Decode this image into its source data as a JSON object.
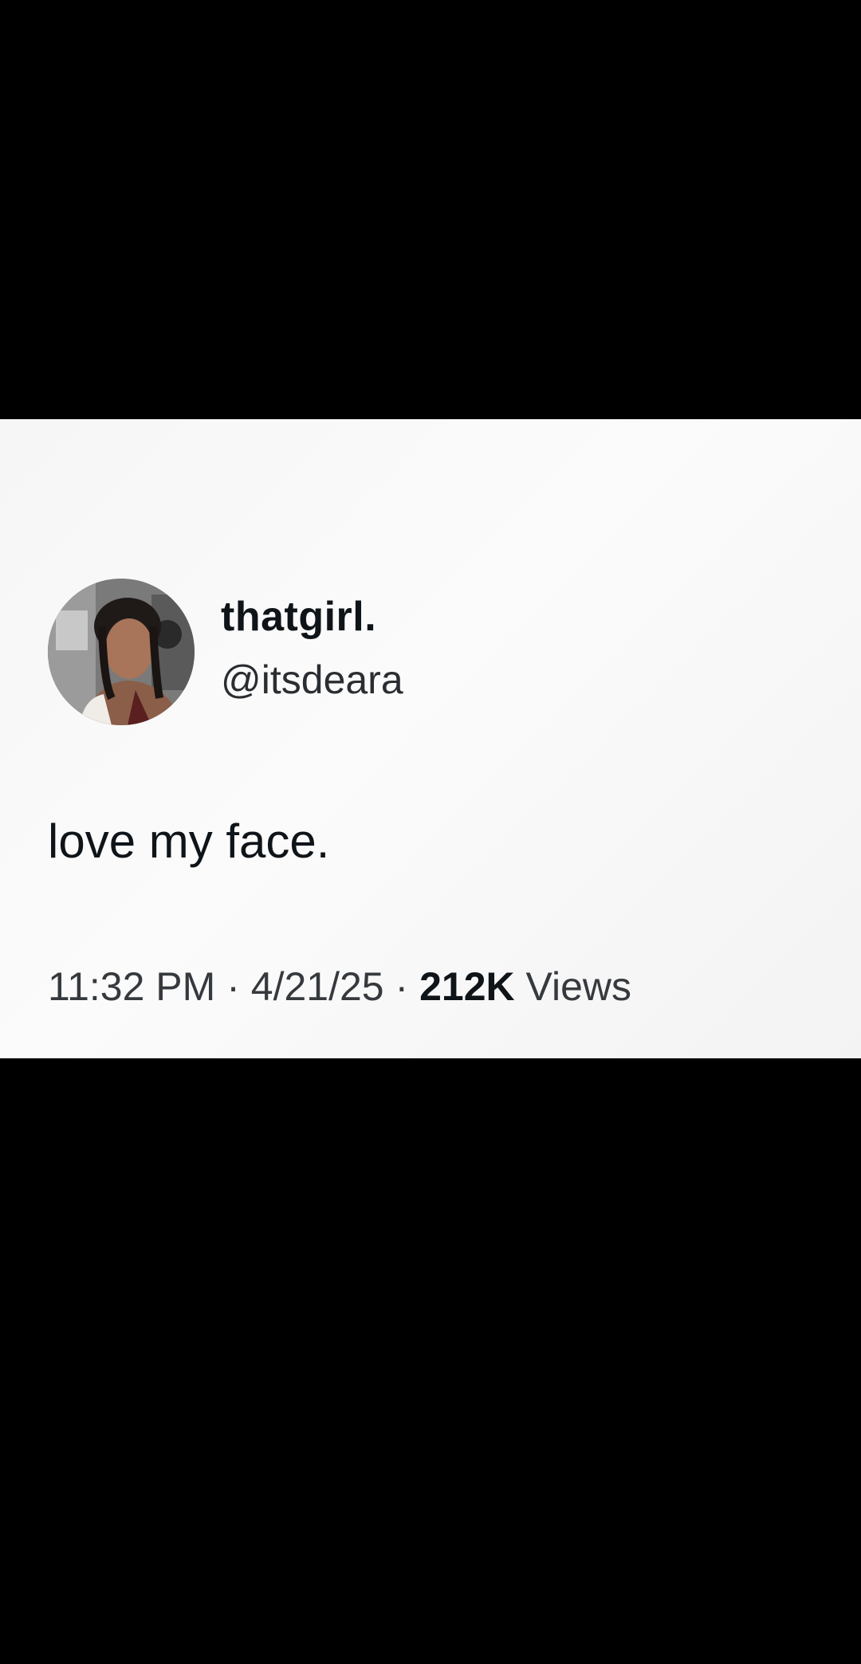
{
  "tweet": {
    "display_name": "thatgirl.",
    "handle": "@itsdeara",
    "text": "love my face.",
    "time": "11:32 PM",
    "separator": "·",
    "date": "4/21/25",
    "views_count": "212K",
    "views_label": "Views"
  },
  "colors": {
    "page_background": "#000000",
    "card_background": "#f7f7f7",
    "primary_text": "#0f1419",
    "secondary_text": "#36393d"
  }
}
